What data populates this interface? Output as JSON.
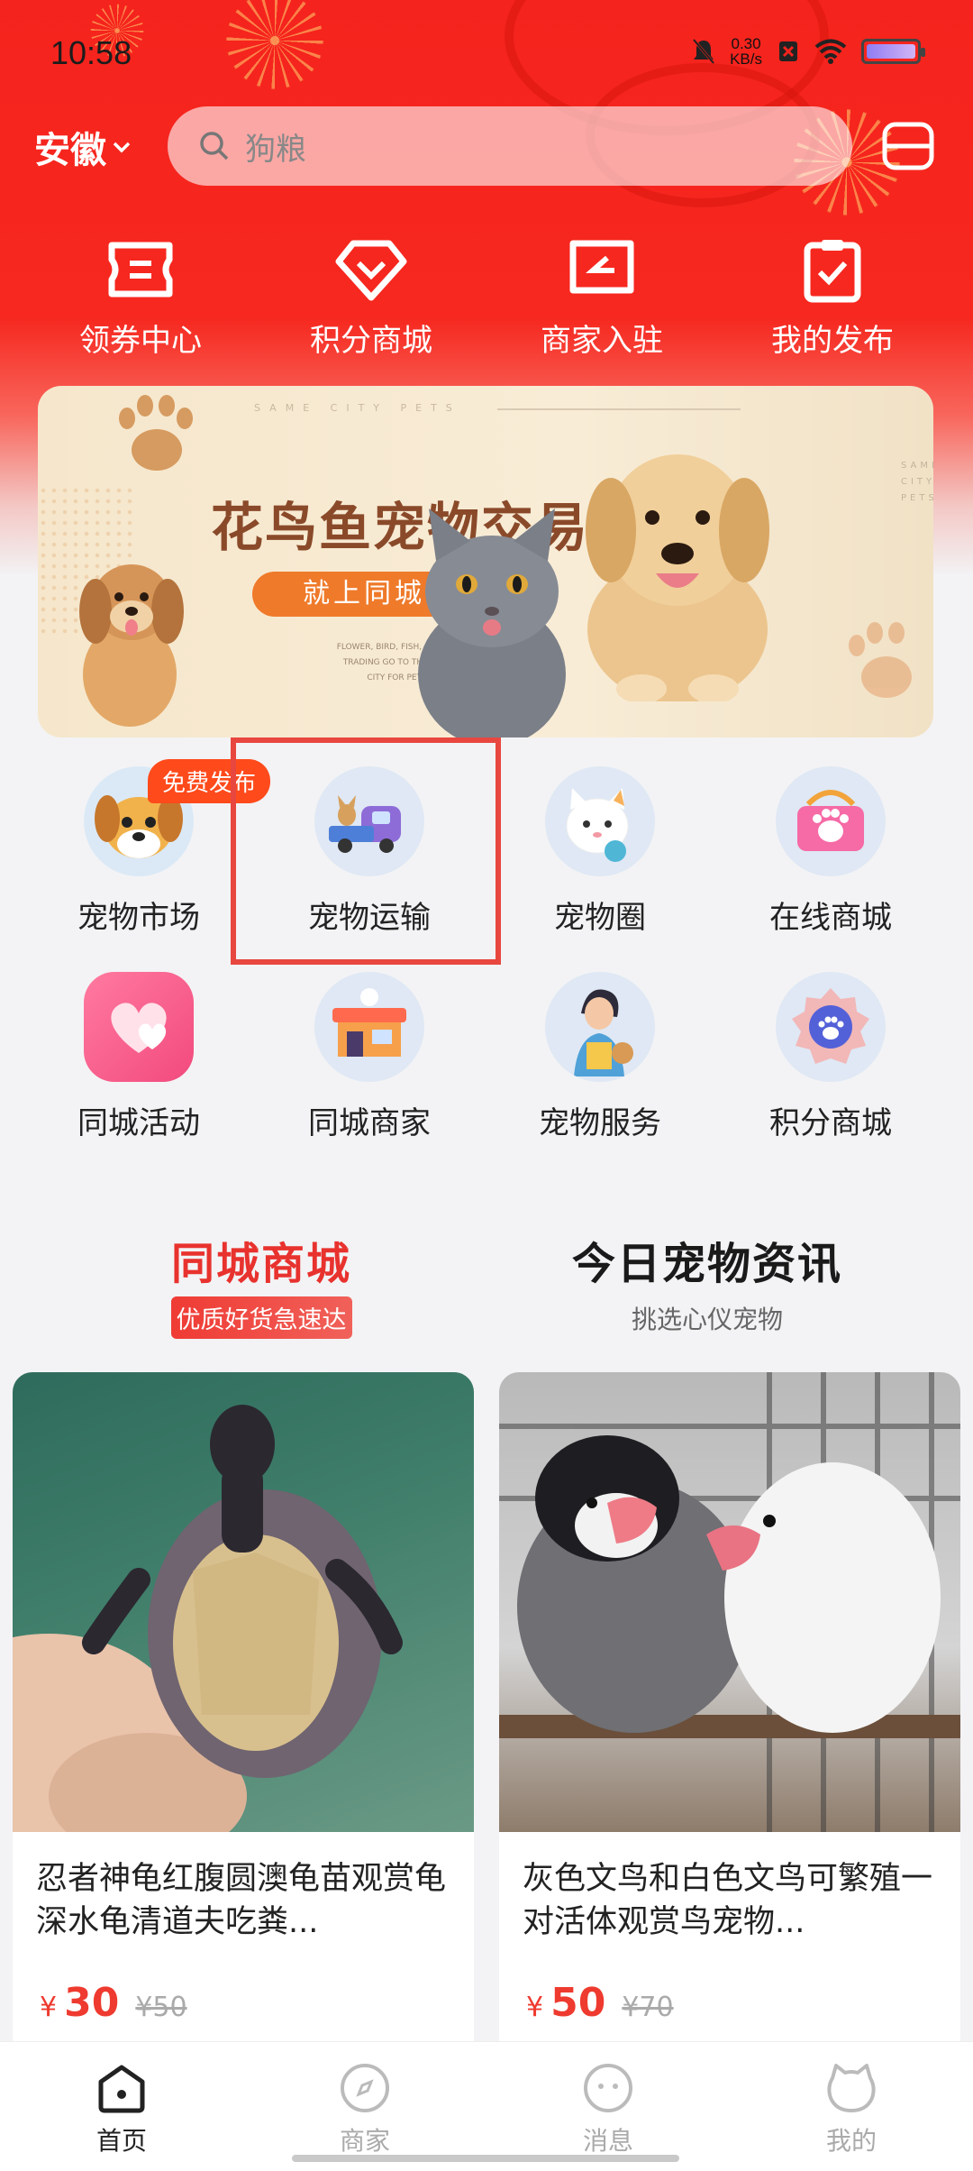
{
  "status_bar": {
    "time": "10:58",
    "speed_value": "0.30",
    "speed_unit": "KB/s"
  },
  "header": {
    "location": "安徽",
    "search_placeholder": "狗粮"
  },
  "quick_actions": [
    {
      "label": "领券中心",
      "icon": "coupon-icon"
    },
    {
      "label": "积分商城",
      "icon": "diamond-icon"
    },
    {
      "label": "商家入驻",
      "icon": "merchant-entry-icon"
    },
    {
      "label": "我的发布",
      "icon": "clipboard-check-icon"
    }
  ],
  "banner": {
    "title": "花鸟鱼宠物交易",
    "pill": "就上同城宠物",
    "top_text": "SAME CITY PETS",
    "small_text": "FLOWER, BIRD, FISH, AND PET TRADING GO TO THE SAME CITY FOR PETS.",
    "side_text": "SAME CITY PETS"
  },
  "categories": {
    "row1": [
      {
        "label": "宠物市场",
        "badge": "免费发布"
      },
      {
        "label": "宠物运输"
      },
      {
        "label": "宠物圈"
      },
      {
        "label": "在线商城"
      }
    ],
    "row2": [
      {
        "label": "同城活动"
      },
      {
        "label": "同城商家"
      },
      {
        "label": "宠物服务"
      },
      {
        "label": "积分商城"
      }
    ]
  },
  "sections": {
    "left": {
      "title": "同城商城",
      "subtitle": "优质好货急速达"
    },
    "right": {
      "title": "今日宠物资讯",
      "subtitle": "挑选心仪宠物"
    }
  },
  "products": [
    {
      "title": "忍者神龟红腹圆澳龟苗观赏龟深水龟清道夫吃粪...",
      "currency": "¥",
      "price": "30",
      "old_price": "¥50"
    },
    {
      "title": "灰色文鸟和白色文鸟可繁殖一对活体观赏鸟宠物...",
      "currency": "¥",
      "price": "50",
      "old_price": "¥70"
    }
  ],
  "bottom_nav": [
    {
      "label": "首页",
      "active": true
    },
    {
      "label": "商家"
    },
    {
      "label": "消息"
    },
    {
      "label": "我的"
    }
  ],
  "colors": {
    "brand_red": "#f5231d",
    "price_red": "#ee3a2f",
    "badge_orange": "#ff4a1b",
    "highlight": "#e8473f"
  }
}
